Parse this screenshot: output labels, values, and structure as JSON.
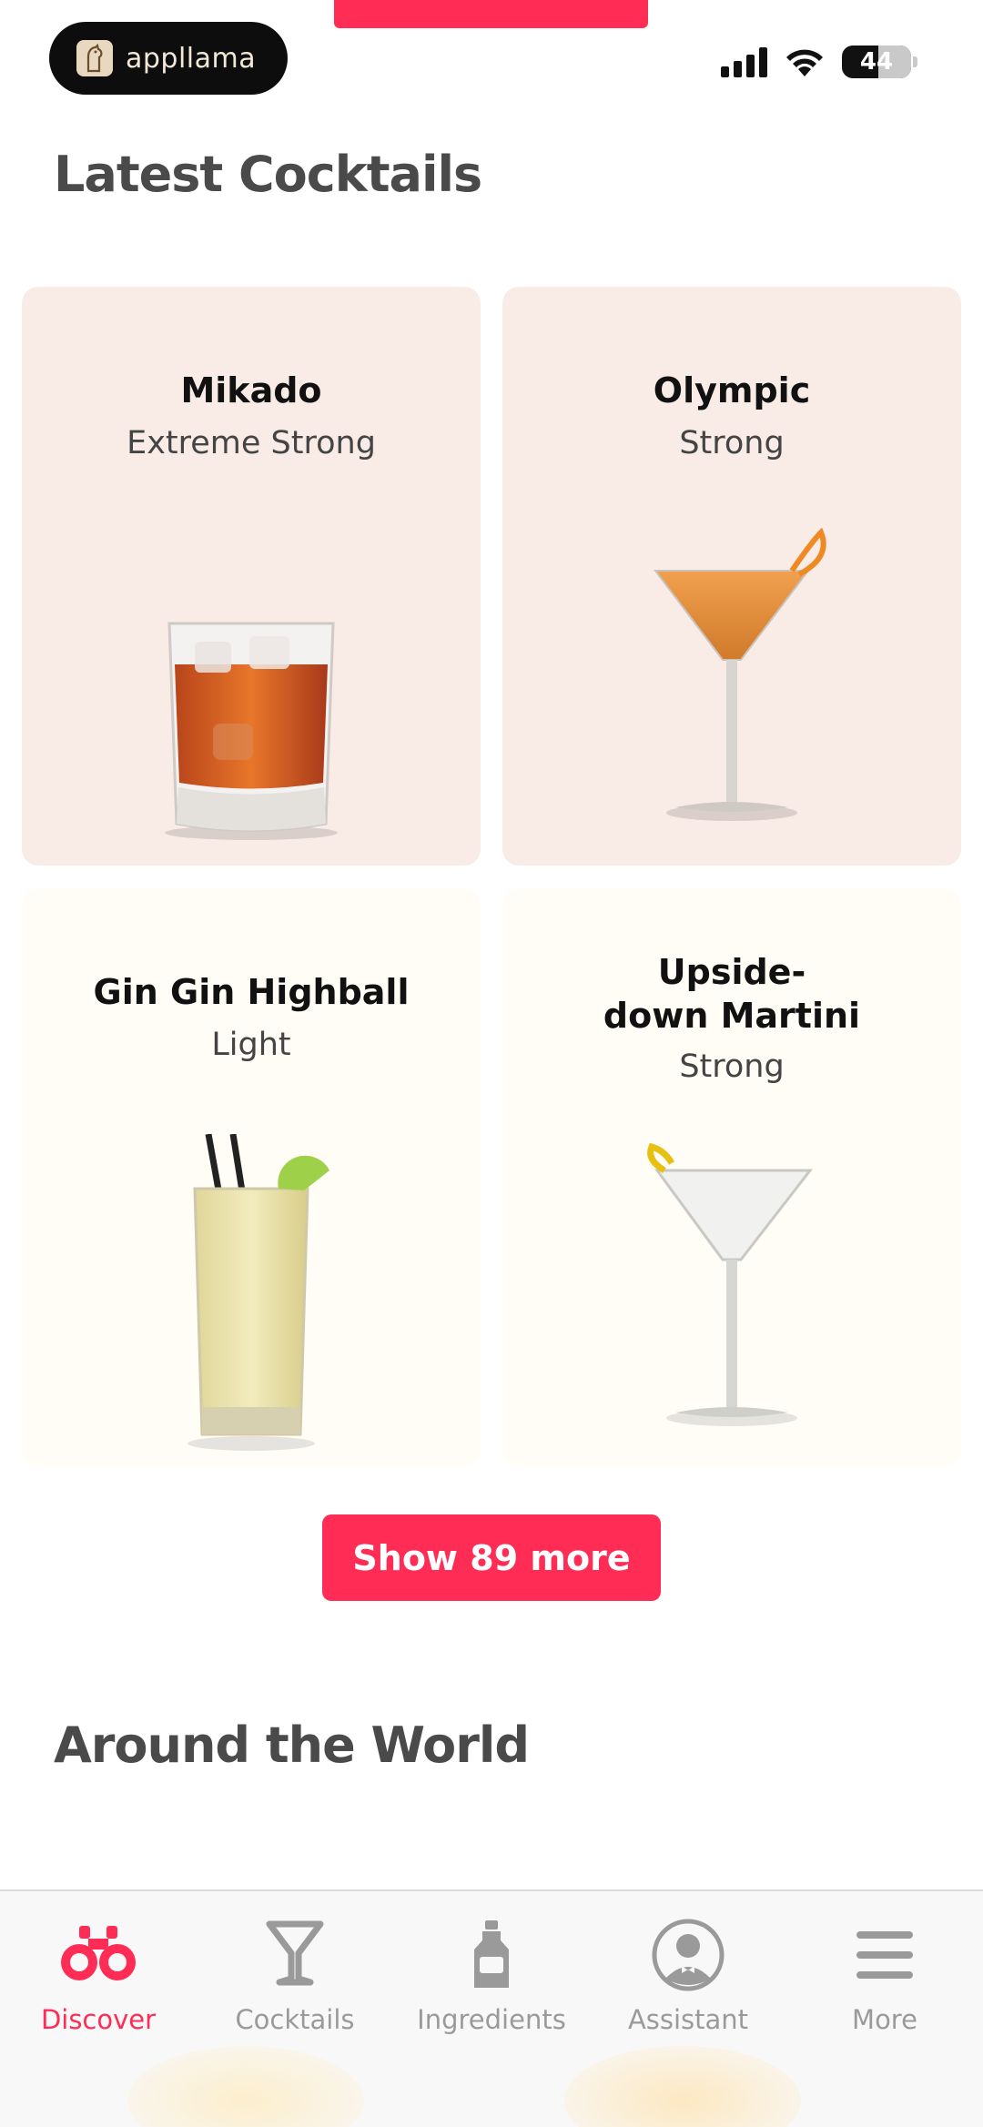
{
  "status_bar": {
    "app_badge": "appllama",
    "battery": "44"
  },
  "sections": {
    "latest_title": "Latest Cocktails",
    "world_title": "Around the World"
  },
  "cocktails": [
    {
      "name": "Mikado",
      "strength": "Extreme Strong",
      "glass": "rocks-glass",
      "bg": "#f9ebe6"
    },
    {
      "name": "Olympic",
      "strength": "Strong",
      "glass": "martini-glass-orange",
      "bg": "#f9ebe6"
    },
    {
      "name": "Gin Gin Highball",
      "strength": "Light",
      "glass": "highball-glass",
      "bg": "#fffdf6"
    },
    {
      "name_line1": "Upside-",
      "name_line2": "down Martini",
      "strength": "Strong",
      "glass": "martini-glass-clear",
      "bg": "#fffdf6"
    }
  ],
  "show_more_label": "Show 89 more",
  "tabbar": {
    "tabs": [
      {
        "label": "Discover",
        "icon": "binoculars-icon",
        "active": true
      },
      {
        "label": "Cocktails",
        "icon": "cocktail-glass-icon",
        "active": false
      },
      {
        "label": "Ingredients",
        "icon": "bottle-icon",
        "active": false
      },
      {
        "label": "Assistant",
        "icon": "bartender-icon",
        "active": false
      },
      {
        "label": "More",
        "icon": "menu-icon",
        "active": false
      }
    ]
  },
  "colors": {
    "accent": "#ff2d55",
    "card_pink": "#f9ebe6",
    "card_cream": "#fffdf6",
    "inactive_tab": "#9a9a9a"
  }
}
